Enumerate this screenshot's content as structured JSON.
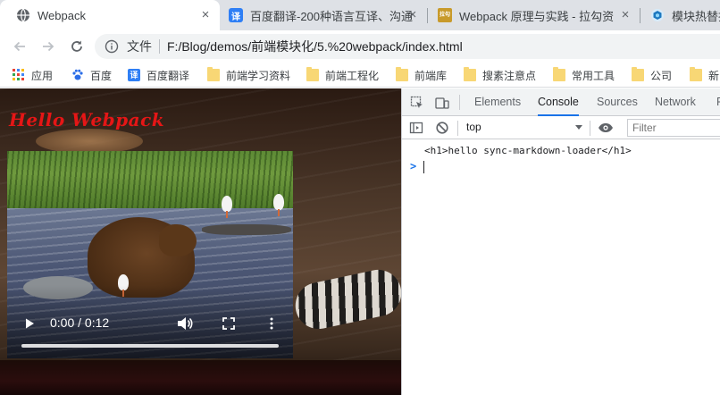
{
  "browser": {
    "tabs": [
      {
        "title": "Webpack",
        "favicon": "globe-icon",
        "active": true,
        "close": "×"
      },
      {
        "title": "百度翻译-200种语言互译、沟通",
        "favicon": "baidu-translate-icon",
        "icon_text": "译",
        "active": false,
        "close": "×"
      },
      {
        "title": "Webpack 原理与实践 - 拉勾资",
        "favicon": "lagou-icon",
        "icon_text": "拉勾",
        "active": false,
        "close": "×"
      },
      {
        "title": "模块热替换",
        "favicon": "webpack-cube-icon",
        "active": false
      }
    ],
    "toolbar": {
      "back": "arrow-left-icon",
      "forward": "arrow-right-icon",
      "reload": "reload-icon",
      "site_info": "info-icon",
      "scheme_label": "文件",
      "url": "F:/Blog/demos/前端模块化/5.%20webpack/index.html"
    },
    "bookmarks": [
      {
        "label": "应用",
        "icon": "apps-grid-icon"
      },
      {
        "label": "百度",
        "icon": "baidu-paw-icon"
      },
      {
        "label": "百度翻译",
        "icon": "baidu-translate-icon",
        "icon_text": "译"
      },
      {
        "label": "前端学习资料",
        "icon": "folder-icon"
      },
      {
        "label": "前端工程化",
        "icon": "folder-icon"
      },
      {
        "label": "前端库",
        "icon": "folder-icon"
      },
      {
        "label": "搜素注意点",
        "icon": "folder-icon"
      },
      {
        "label": "常用工具",
        "icon": "folder-icon"
      },
      {
        "label": "公司",
        "icon": "folder-icon"
      },
      {
        "label": "新",
        "icon": "folder-icon"
      }
    ]
  },
  "page": {
    "heading": "Hello Webpack",
    "video": {
      "time": "0:00 / 0:12",
      "progress": 0.0,
      "controls": [
        "play-icon",
        "volume-icon",
        "fullscreen-icon",
        "more-vert-icon"
      ]
    }
  },
  "devtools": {
    "tabs": [
      "Elements",
      "Console",
      "Sources",
      "Network",
      "P"
    ],
    "active_tab": "Console",
    "console_context": "top",
    "filter_placeholder": "Filter",
    "log_lines": [
      "<h1>hello sync-markdown-loader</h1>"
    ],
    "prompt_symbol": ">"
  },
  "colors": {
    "accent": "#1a73e8",
    "heading_red": "#e51616",
    "tab_strip": "#dee1e6",
    "folder": "#f8d775"
  }
}
